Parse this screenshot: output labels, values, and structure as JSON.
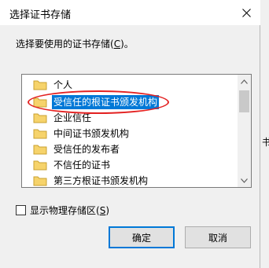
{
  "dialog": {
    "title": "选择证书存储",
    "prompt": "选择要使用的证书存储(",
    "prompt_accel": "C",
    "prompt_end": ")。"
  },
  "tree": {
    "items": [
      {
        "label": "个人",
        "selected": false
      },
      {
        "label": "受信任的根证书颁发机构",
        "selected": true
      },
      {
        "label": "企业信任",
        "selected": false
      },
      {
        "label": "中间证书颁发机构",
        "selected": false
      },
      {
        "label": "受信任的发布者",
        "selected": false
      },
      {
        "label": "不信任的证书",
        "selected": false
      },
      {
        "label": "第三方根证书颁发机构",
        "selected": false
      }
    ]
  },
  "checkbox": {
    "label": "显示物理存储区(",
    "accel": "S",
    "label_end": ")",
    "checked": false
  },
  "buttons": {
    "ok": "确定",
    "cancel": "取消"
  },
  "side_text": "书",
  "colors": {
    "selection": "#0078d7",
    "annotation": "#e32222",
    "folder": "#f6d36b"
  }
}
